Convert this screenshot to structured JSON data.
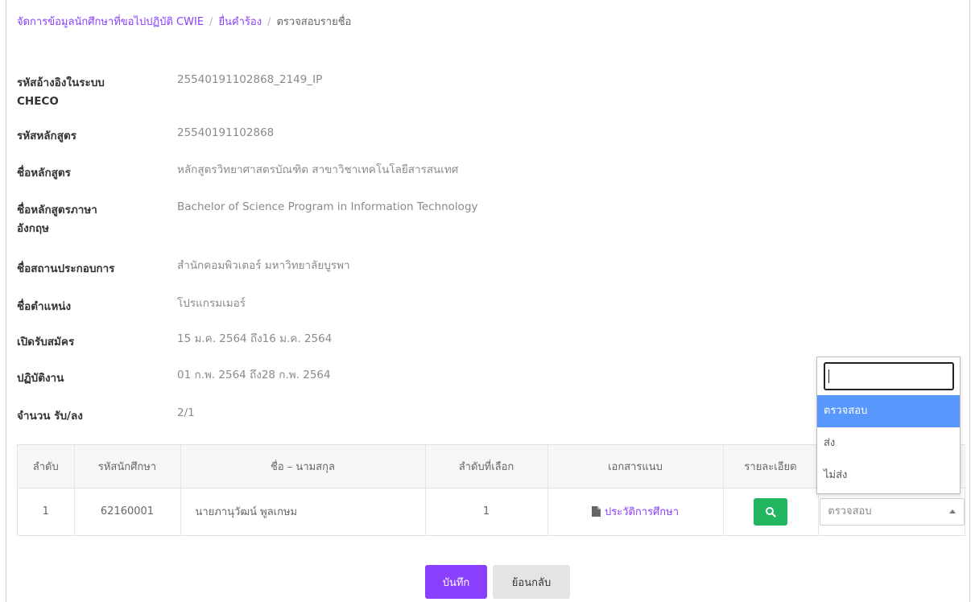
{
  "breadcrumb": {
    "items": [
      "จัดการข้อมูลนักศึกษาที่ขอไปปฏิบัติ CWIE",
      "ยื่นคำร้อง"
    ],
    "current": "ตรวจสอบรายชื่อ"
  },
  "info": {
    "checco_ref": {
      "label_line1": "รหัสอ้างอิงในระบบ",
      "label_line2": "CHECO",
      "value": "25540191102868_2149_IP"
    },
    "curriculum_code": {
      "label": "รหัสหลักสูตร",
      "value": "25540191102868"
    },
    "curriculum_name": {
      "label": "ชื่อหลักสูตร",
      "value": "หลักสูตรวิทยาศาสตรบัณฑิต สาขาวิชาเทคโนโลยีสารสนเทศ"
    },
    "curriculum_name_en": {
      "label_line1": "ชื่อหลักสูตรภาษา",
      "label_line2": "อังกฤษ",
      "value": "Bachelor of Science Program in Information Technology"
    },
    "workplace": {
      "label": "ชื่อสถานประกอบการ",
      "value": "สำนักคอมพิวเตอร์ มหาวิทยาลัยบูรพา"
    },
    "position": {
      "label": "ชื่อตำแหน่ง",
      "value": "โปรแกรมเมอร์"
    },
    "application_period": {
      "label": "เปิดรับสมัคร",
      "value": "15 ม.ค. 2564 ถึง16 ม.ค. 2564"
    },
    "work_period": {
      "label": "ปฏิบัติงาน",
      "value": "01 ก.พ. 2564 ถึง28 ก.พ. 2564"
    },
    "quota": {
      "label": "จำนวน รับ/ลง",
      "value": "2/1"
    }
  },
  "table": {
    "headers": [
      "ลำดับ",
      "รหัสนักศึกษา",
      "ชื่อ – นามสกุล",
      "ลำดับที่เลือก",
      "เอกสารแนบ",
      "รายละเอียด",
      ""
    ],
    "rows": [
      {
        "index": "1",
        "student_id": "62160001",
        "name": "นายภานุวัฒน์ พูลเกษม",
        "choice_order": "1",
        "attachment": "ประวัติการศึกษา",
        "status": "ตรวจสอบ"
      }
    ]
  },
  "dropdown": {
    "search_value": "",
    "options": [
      "ตรวจสอบ",
      "ส่ง",
      "ไม่ส่ง"
    ],
    "selected_index": 0
  },
  "actions": {
    "save_label": "บันทึก",
    "back_label": "ย้อนกลับ"
  },
  "colors": {
    "accent": "#8a3ffc",
    "success": "#21b65f",
    "highlight": "#5897fb"
  }
}
